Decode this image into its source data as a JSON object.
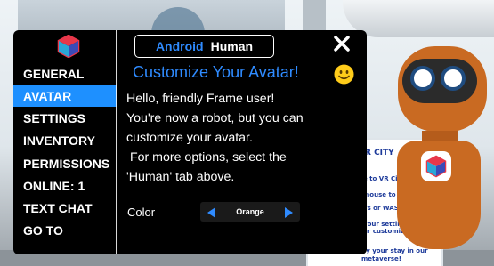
{
  "sidebar": {
    "logo_icon": "frame-cube-logo-icon",
    "items": [
      {
        "label": "GENERAL",
        "active": false
      },
      {
        "label": "AVATAR",
        "active": true
      },
      {
        "label": "SETTINGS",
        "active": false
      },
      {
        "label": "INVENTORY",
        "active": false
      },
      {
        "label": "PERMISSIONS",
        "active": false
      },
      {
        "label": "ONLINE: 1",
        "active": false
      },
      {
        "label": "TEXT CHAT",
        "active": false
      },
      {
        "label": "GO TO",
        "active": false
      }
    ]
  },
  "tabs": {
    "android_label": "Android",
    "human_label": "Human",
    "selected": "Android"
  },
  "close_icon": "close-icon",
  "heading": "Customize Your Avatar!",
  "heading_icon": "smiley-icon",
  "body_lines": [
    "Hello, friendly Frame user!",
    "You're now a robot, but you can",
    "customize your avatar.",
    " For more options, select the",
    "'Human' tab above."
  ],
  "color": {
    "label": "Color",
    "value": "Orange",
    "prev_icon": "triangle-left-icon",
    "next_icon": "triangle-right-icon"
  },
  "background_sign": {
    "city_text": "R CITY",
    "lines": [
      "e to VR Cit",
      "mouse to",
      "ys or WASD",
      "your setting",
      "ur customizabl",
      "joy your stay in our",
      "metaverse!"
    ]
  },
  "colors": {
    "accent_blue": "#1e90ff",
    "heading_blue": "#2f8bff",
    "panel_bg": "#000000",
    "robot_orange": "#c96a22"
  }
}
